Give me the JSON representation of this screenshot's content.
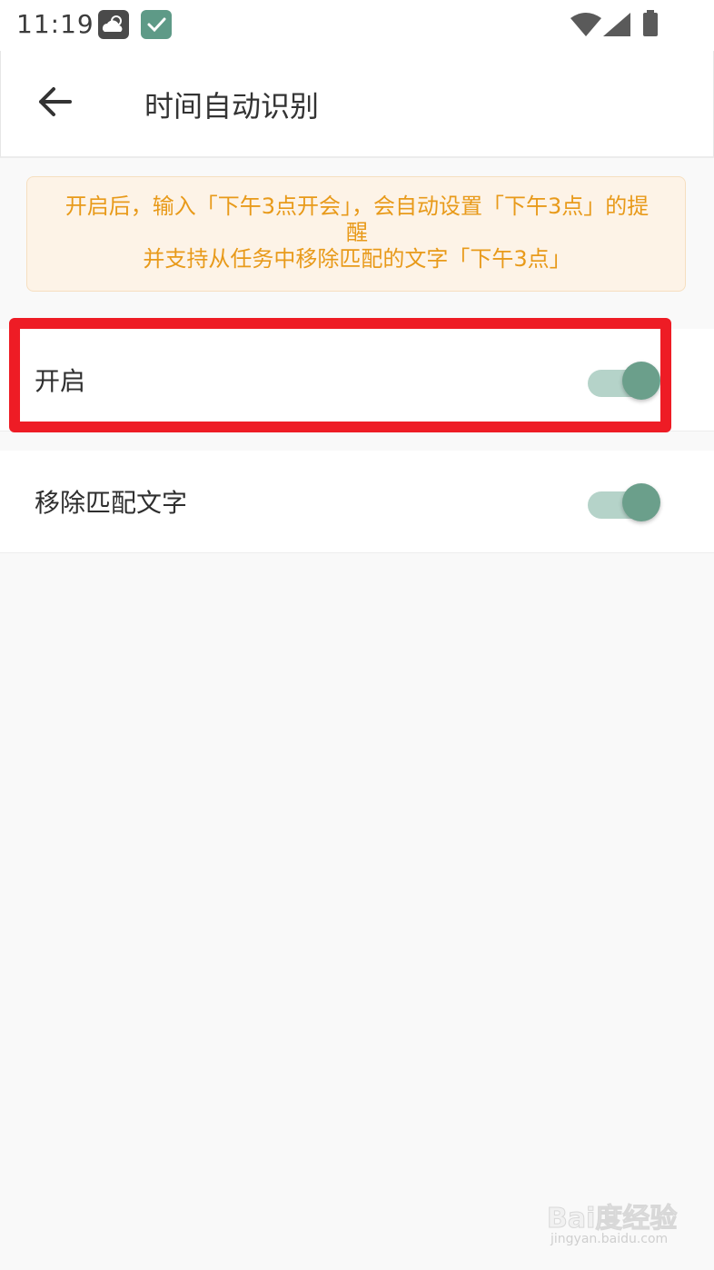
{
  "status_bar": {
    "time": "11:19",
    "icons": [
      "weather-cloud-icon",
      "app-check-icon",
      "wifi-icon",
      "cell-signal-icon",
      "battery-icon"
    ]
  },
  "app_bar": {
    "back_icon": "arrow-left-icon",
    "title": "时间自动识别"
  },
  "notice": {
    "line1": "开启后，输入「下午3点开会」，会自动设置「下午3点」的提醒",
    "line2": "并支持从任务中移除匹配的文字「下午3点」"
  },
  "settings": [
    {
      "label": "开启",
      "enabled": true
    },
    {
      "label": "移除匹配文字",
      "enabled": true
    }
  ],
  "watermark": {
    "brand": "Bai度经验",
    "url": "jingyan.baidu.com"
  },
  "colors": {
    "accent": "#6b9f8b",
    "toggle_track": "#b5d3c9",
    "notice_text": "#e89a1a",
    "notice_bg": "#fdf3e7",
    "highlight": "#ee1c25"
  }
}
